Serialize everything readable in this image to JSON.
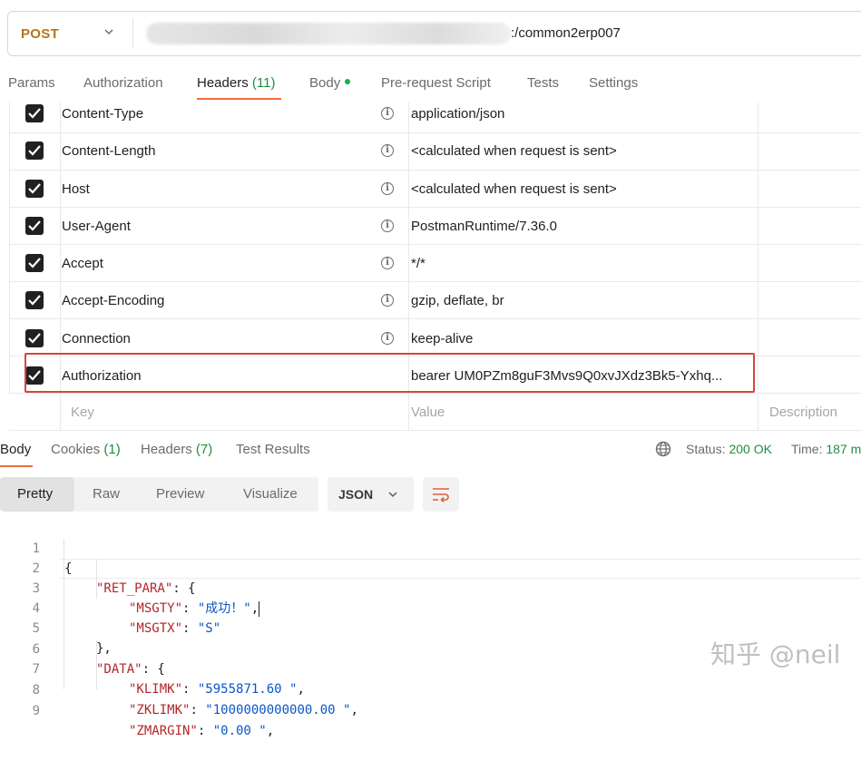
{
  "request": {
    "method": "POST",
    "url_suffix": ":/common2erp007"
  },
  "request_tabs": [
    {
      "label": "Params"
    },
    {
      "label": "Authorization"
    },
    {
      "label": "Headers",
      "count": "(11)"
    },
    {
      "label": "Body"
    },
    {
      "label": "Pre-request Script"
    },
    {
      "label": "Tests"
    },
    {
      "label": "Settings"
    }
  ],
  "headers": [
    {
      "key": "Content-Type",
      "value": "application/json"
    },
    {
      "key": "Content-Length",
      "value": "<calculated when request is sent>"
    },
    {
      "key": "Host",
      "value": "<calculated when request is sent>"
    },
    {
      "key": "User-Agent",
      "value": "PostmanRuntime/7.36.0"
    },
    {
      "key": "Accept",
      "value": "*/*"
    },
    {
      "key": "Accept-Encoding",
      "value": "gzip, deflate, br"
    },
    {
      "key": "Connection",
      "value": "keep-alive"
    },
    {
      "key": "Authorization",
      "value": "bearer UM0PZm8guF3Mvs9Q0xvJXdz3Bk5-Yxhq..."
    }
  ],
  "new_header": {
    "key_placeholder": "Key",
    "value_placeholder": "Value",
    "description_placeholder": "Description"
  },
  "response_tabs": [
    {
      "label": "Body"
    },
    {
      "label": "Cookies",
      "count": "(1)"
    },
    {
      "label": "Headers",
      "count": "(7)"
    },
    {
      "label": "Test Results"
    }
  ],
  "status": {
    "status_label": "Status:",
    "status_value": "200 OK",
    "time_label": "Time:",
    "time_value": "187 m"
  },
  "view_modes": [
    "Pretty",
    "Raw",
    "Preview",
    "Visualize"
  ],
  "format": "JSON",
  "code_lines": [
    {
      "n": "1",
      "text": "{"
    },
    {
      "n": "2",
      "key": "\"RET_PARA\"",
      "rest": ": {"
    },
    {
      "n": "3",
      "key": "\"MSGTY\"",
      "sep": ": ",
      "str": "\"成功！\"",
      "tail": ","
    },
    {
      "n": "4",
      "key": "\"MSGTX\"",
      "sep": ": ",
      "str": "\"S\"",
      "tail": ""
    },
    {
      "n": "5",
      "text": "},"
    },
    {
      "n": "6",
      "key": "\"DATA\"",
      "rest": ": {"
    },
    {
      "n": "7",
      "key": "\"KLIMK\"",
      "sep": ": ",
      "str": "\"5955871.60 \"",
      "tail": ","
    },
    {
      "n": "8",
      "key": "\"ZKLIMK\"",
      "sep": ": ",
      "str": "\"1000000000000.00 \"",
      "tail": ","
    },
    {
      "n": "9",
      "key": "\"ZMARGIN\"",
      "sep": ": ",
      "str": "\"0.00 \"",
      "tail": ","
    }
  ],
  "watermark": "知乎 @neil",
  "colors": {
    "accent": "#f26b3a",
    "method": "#b8721d",
    "success": "#1f8e3d",
    "json_key": "#b3262a",
    "json_string": "#0b55c6",
    "highlight": "#d64541"
  }
}
